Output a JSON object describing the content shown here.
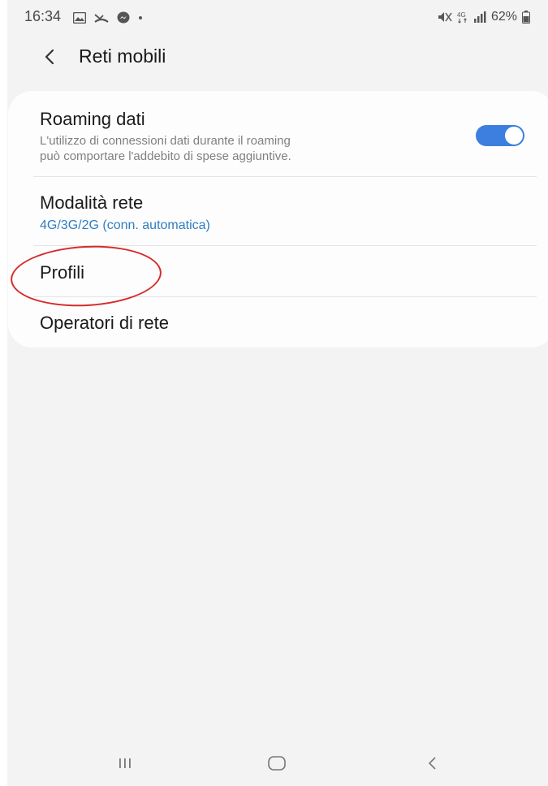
{
  "status_bar": {
    "time": "16:34",
    "battery": "62%",
    "network": "4G",
    "left_icons": [
      "gallery-icon",
      "missed-call-icon",
      "messenger-icon",
      "dot-icon"
    ],
    "right_icons": [
      "mute-icon",
      "4g-icon",
      "signal-icon",
      "battery-icon"
    ]
  },
  "header": {
    "title": "Reti mobili",
    "back_icon": "chevron-left-icon"
  },
  "settings": {
    "roaming": {
      "title": "Roaming dati",
      "description_line1": "L'utilizzo di connessioni dati durante il roaming",
      "description_line2": "può comportare l'addebito di spese aggiuntive.",
      "enabled": true
    },
    "network_mode": {
      "title": "Modalità rete",
      "value": "4G/3G/2G (conn. automatica)"
    },
    "profiles": {
      "title": "Profili"
    },
    "operators": {
      "title": "Operatori di rete"
    }
  },
  "annotation": {
    "color": "#d62a2a",
    "target": "Profili"
  },
  "nav_bar": {
    "buttons": [
      "recents-icon",
      "home-icon",
      "back-icon"
    ]
  },
  "colors": {
    "accent": "#3d7fde",
    "link": "#2f7ec1",
    "background": "#f3f3f3",
    "card": "#fdfdfd"
  }
}
